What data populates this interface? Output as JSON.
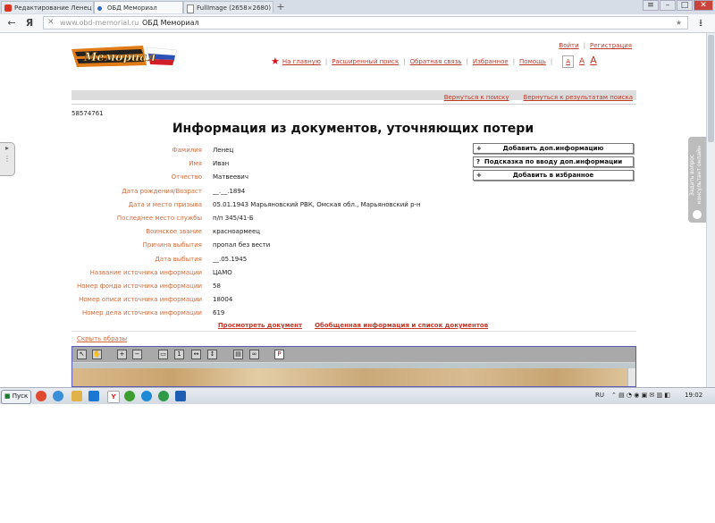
{
  "browser": {
    "tabs": [
      {
        "label": "Редактирование Ленец",
        "active": false
      },
      {
        "label": "ОБД Мемориал",
        "active": true
      },
      {
        "label": "FullImage (2658×2680)",
        "active": false
      }
    ],
    "window_controls": [
      "–",
      "□",
      "✕"
    ],
    "nav": {
      "back": "←",
      "yandex": "Я"
    },
    "url_domain": "www.obd-memorial.ru",
    "url_title": "ОБД Мемориал"
  },
  "site": {
    "logo_text": "Мемориал",
    "auth": {
      "login": "Войти",
      "register": "Регистрация"
    },
    "nav": [
      "На главную",
      "Расширенный поиск",
      "Обратная связь",
      "Избранное",
      "Помощь"
    ],
    "font_sizes": [
      "A",
      "A",
      "A"
    ],
    "back_links": [
      "Вернуться к поиску",
      "Вернуться к результатам поиска"
    ],
    "record_id": "58574761",
    "heading": "Информация из документов, уточняющих потери",
    "fields": [
      {
        "label": "Фамилия",
        "value": "Ленец"
      },
      {
        "label": "Имя",
        "value": "Иван"
      },
      {
        "label": "Отчество",
        "value": "Матвеевич"
      },
      {
        "label": "Дата рождения/Возраст",
        "value": "__.__.1894"
      },
      {
        "label": "Дата и место призыва",
        "value": "05.01.1943 Марьяновский РВК, Омская обл., Марьяновский р-н"
      },
      {
        "label": "Последнее место службы",
        "value": "п/п 345/41-Б"
      },
      {
        "label": "Воинское звание",
        "value": "красноармеец"
      },
      {
        "label": "Причина выбытия",
        "value": "пропал без вести"
      },
      {
        "label": "Дата выбытия",
        "value": "__.05.1945"
      },
      {
        "label": "Название источника информации",
        "value": "ЦАМО"
      },
      {
        "label": "Номер фонда источника информации",
        "value": "58"
      },
      {
        "label": "Номер описи источника информации",
        "value": "18004"
      },
      {
        "label": "Номер дела источника информации",
        "value": "619"
      }
    ],
    "actions": [
      {
        "prefix": "+",
        "label": "Добавить доп.информацию"
      },
      {
        "prefix": "?",
        "label": "Подсказка по вводу доп.информации"
      },
      {
        "prefix": "+",
        "label": "Добавить в избранное"
      }
    ],
    "doc_links": [
      "Просмотреть документ",
      "Обобщенная информация и список документов"
    ],
    "hide_images": "Скрыть образы",
    "side_widget": "Задать вопрос консультант онлайн",
    "left_widget": "▸"
  },
  "taskbar": {
    "start": "Пуск",
    "language": "RU",
    "time": "19:02"
  },
  "colors": {
    "link": "#c0392b",
    "label": "#d26b3c",
    "gray_bar": "#dcdcdc"
  }
}
